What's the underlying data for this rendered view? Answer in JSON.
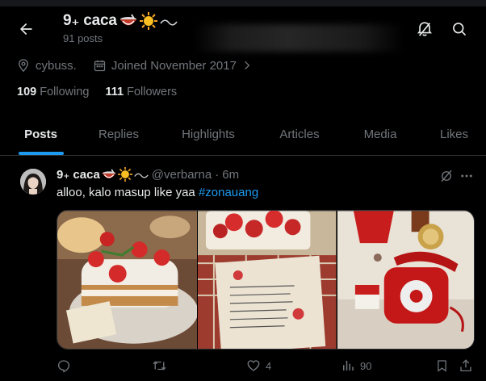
{
  "header": {
    "display_name": "9₊ caca",
    "post_count": "91 posts"
  },
  "profile": {
    "location": "cybuss.",
    "joined": "Joined November 2017",
    "following_count": "109",
    "following_label": "Following",
    "followers_count": "111",
    "followers_label": "Followers"
  },
  "tabs": [
    {
      "label": "Posts",
      "active": true
    },
    {
      "label": "Replies",
      "active": false
    },
    {
      "label": "Highlights",
      "active": false
    },
    {
      "label": "Articles",
      "active": false
    },
    {
      "label": "Media",
      "active": false
    },
    {
      "label": "Likes",
      "active": false
    }
  ],
  "post": {
    "author_name": "9₊ caca",
    "handle": "@verbarna",
    "separator": "·",
    "time": "6m",
    "text": "alloo, kalo masup like yaa ",
    "hashtag": "#zonauang",
    "replies": "",
    "reposts": "",
    "likes": "4",
    "views": "90"
  },
  "icons": {
    "back": "arrow-left-icon",
    "notifications_off": "bell-slash-icon",
    "search": "search-icon",
    "location": "location-pin-icon",
    "calendar": "calendar-icon",
    "more": "more-dots-icon",
    "grok": "grok-icon"
  },
  "colors": {
    "accent": "#1d9bf0",
    "text": "#e7e9ea",
    "muted": "#71767b",
    "background": "#000000",
    "border": "#2f3336"
  }
}
